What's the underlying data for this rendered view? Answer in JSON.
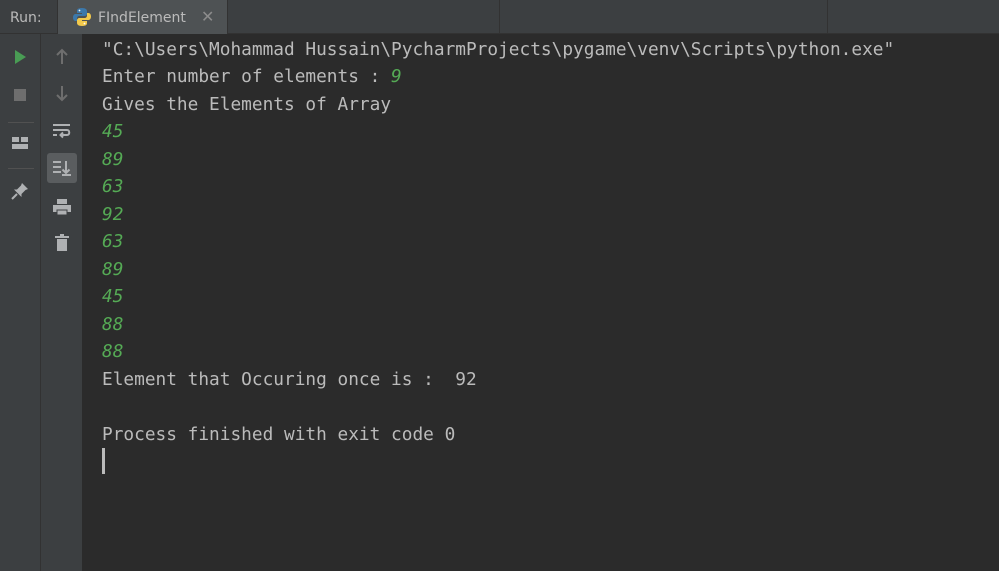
{
  "run_label": "Run:",
  "tab": {
    "title": "FIndElement",
    "close_glyph": "✕",
    "icon": "python-icon"
  },
  "toolbar_left": {
    "buttons": [
      {
        "name": "rerun-icon",
        "color": "#499c54"
      },
      {
        "name": "stop-icon",
        "color": "#6e6e6e"
      },
      {
        "name": "layout-icon",
        "color": "#afb1b3"
      },
      {
        "name": "pin-icon",
        "color": "#afb1b3"
      }
    ]
  },
  "toolbar_right": {
    "buttons": [
      {
        "name": "up-arrow-icon"
      },
      {
        "name": "down-arrow-icon"
      },
      {
        "name": "soft-wrap-icon"
      },
      {
        "name": "scroll-to-end-icon",
        "active": true
      },
      {
        "name": "print-icon"
      },
      {
        "name": "trash-icon"
      }
    ]
  },
  "console": {
    "command": "\"C:\\Users\\Mohammad Hussain\\PycharmProjects\\pygame\\venv\\Scripts\\python.exe\"",
    "prompt_count": "Enter number of elements : ",
    "count_value": "9",
    "prompt_elements": "Gives the Elements of Array",
    "inputs": [
      "45",
      "89",
      "63",
      "92",
      "63",
      "89",
      "45",
      "88",
      "88"
    ],
    "result": "Element that Occuring once is :  92",
    "exit_message": "Process finished with exit code 0"
  },
  "colors": {
    "background": "#2b2b2b",
    "text": "#bbbbbb",
    "user_input": "#55aa55",
    "run_green": "#499c54"
  }
}
